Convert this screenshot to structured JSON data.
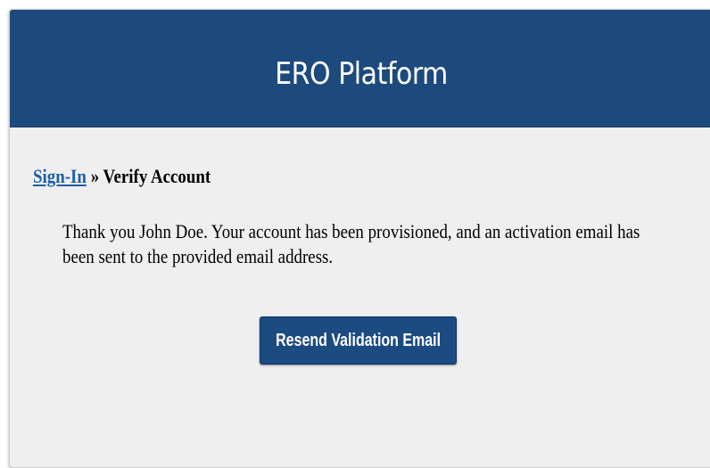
{
  "header": {
    "title": "ERO Platform"
  },
  "breadcrumb": {
    "link_label": "Sign-In",
    "separator": " » ",
    "current": "Verify Account"
  },
  "main": {
    "message": "Thank you John Doe. Your account has been provisioned, and an activation email has been sent to the provided email address.",
    "resend_button_label": "Resend Validation Email"
  },
  "colors": {
    "header_bg": "#1d4a7d",
    "page_bg": "#efefef",
    "link": "#1f5fa8",
    "button_bg": "#1c4b82"
  }
}
